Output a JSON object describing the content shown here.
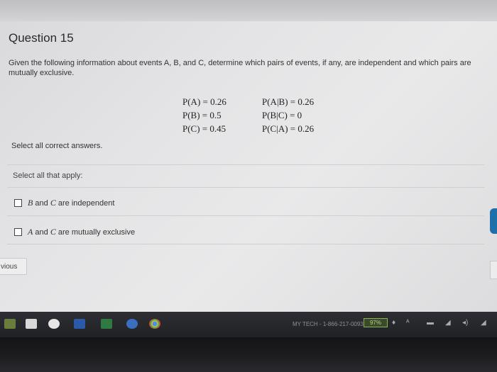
{
  "question": {
    "title": "Question 15",
    "body": "Given the following information about events A, B, and C, determine which pairs of events, if any, are independent and which pairs are mutually exclusive."
  },
  "probabilities": {
    "left": [
      "P(A) = 0.26",
      "P(B) = 0.5",
      "P(C) = 0.45"
    ],
    "right": [
      "P(A|B) = 0.26",
      "P(B|C) = 0",
      "P(C|A) = 0.26"
    ]
  },
  "instructions": {
    "select_all_correct": "Select all correct answers.",
    "select_all_apply": "Select all that apply:"
  },
  "options": [
    {
      "var1": "B",
      "text_mid": " and ",
      "var2": "C",
      "text_end": " are independent"
    },
    {
      "var1": "A",
      "text_mid": " and ",
      "var2": "C",
      "text_end": " are mutually exclusive"
    }
  ],
  "nav": {
    "previous_label": "vious"
  },
  "taskbar": {
    "tray_text": "MY TECH - 1-866-217-0093",
    "battery": "97%"
  },
  "colors": {
    "side_tab": "#1f6fa8",
    "battery_green": "#8fb05a"
  }
}
